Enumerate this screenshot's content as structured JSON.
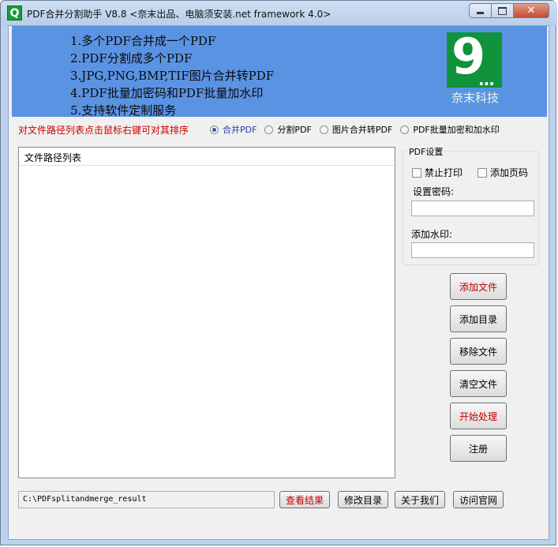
{
  "window": {
    "title": "PDF合并分割助手 V8.8 <奈末出品、电脑须安装.net framework 4.0>",
    "app_icon_glyph": "Q",
    "close_glyph": "✕"
  },
  "banner": {
    "features": [
      "1.多个PDF合并成一个PDF",
      "2.PDF分割成多个PDF",
      "3.JPG,PNG,BMP,TIF图片合并转PDF",
      "4.PDF批量加密码和PDF批量加水印",
      "5.支持软件定制服务"
    ],
    "logo_text": "奈末科技",
    "logo_glyph": "9",
    "logo_dots": "..."
  },
  "sort_hint": "对文件路径列表点击鼠标右键可对其排序",
  "modes": [
    {
      "label": "合并PDF",
      "checked": true
    },
    {
      "label": "分割PDF",
      "checked": false
    },
    {
      "label": "图片合并转PDF",
      "checked": false
    },
    {
      "label": "PDF批量加密和加水印",
      "checked": false
    }
  ],
  "file_list": {
    "header": "文件路径列表"
  },
  "pdf_settings": {
    "legend": "PDF设置",
    "no_print": "禁止打印",
    "add_page_number": "添加页码",
    "password_label": "设置密码:",
    "password_value": "",
    "watermark_label": "添加水印:",
    "watermark_value": ""
  },
  "side_buttons": {
    "add_file": "添加文件",
    "add_folder": "添加目录",
    "remove_file": "移除文件",
    "clear_files": "清空文件",
    "start": "开始处理",
    "register": "注册"
  },
  "bottom": {
    "output_path": "C:\\PDFsplitandmerge_result",
    "view_result": "查看结果",
    "change_dir": "修改目录",
    "about_us": "关于我们",
    "visit_site": "访问官网"
  },
  "colors": {
    "banner_bg": "#5a93e2",
    "logo_bg": "#10933a",
    "hint_red": "#cc0000"
  }
}
